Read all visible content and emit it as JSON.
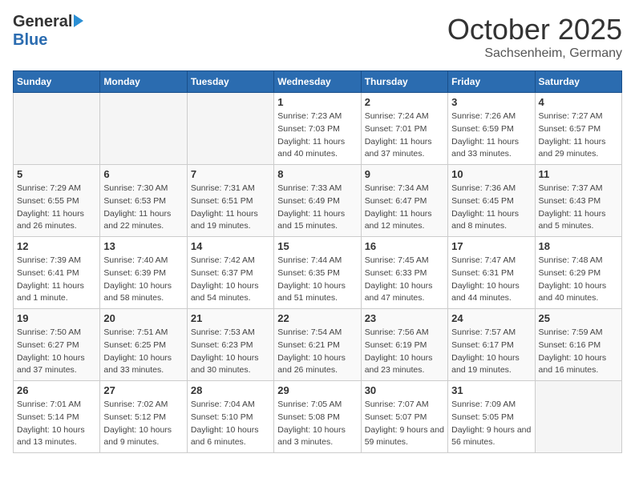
{
  "logo": {
    "general": "General",
    "blue": "Blue"
  },
  "title": "October 2025",
  "location": "Sachsenheim, Germany",
  "weekdays": [
    "Sunday",
    "Monday",
    "Tuesday",
    "Wednesday",
    "Thursday",
    "Friday",
    "Saturday"
  ],
  "weeks": [
    [
      {
        "day": "",
        "empty": true
      },
      {
        "day": "",
        "empty": true
      },
      {
        "day": "",
        "empty": true
      },
      {
        "day": "1",
        "sunrise": "7:23 AM",
        "sunset": "7:03 PM",
        "daylight": "11 hours and 40 minutes."
      },
      {
        "day": "2",
        "sunrise": "7:24 AM",
        "sunset": "7:01 PM",
        "daylight": "11 hours and 37 minutes."
      },
      {
        "day": "3",
        "sunrise": "7:26 AM",
        "sunset": "6:59 PM",
        "daylight": "11 hours and 33 minutes."
      },
      {
        "day": "4",
        "sunrise": "7:27 AM",
        "sunset": "6:57 PM",
        "daylight": "11 hours and 29 minutes."
      }
    ],
    [
      {
        "day": "5",
        "sunrise": "7:29 AM",
        "sunset": "6:55 PM",
        "daylight": "11 hours and 26 minutes."
      },
      {
        "day": "6",
        "sunrise": "7:30 AM",
        "sunset": "6:53 PM",
        "daylight": "11 hours and 22 minutes."
      },
      {
        "day": "7",
        "sunrise": "7:31 AM",
        "sunset": "6:51 PM",
        "daylight": "11 hours and 19 minutes."
      },
      {
        "day": "8",
        "sunrise": "7:33 AM",
        "sunset": "6:49 PM",
        "daylight": "11 hours and 15 minutes."
      },
      {
        "day": "9",
        "sunrise": "7:34 AM",
        "sunset": "6:47 PM",
        "daylight": "11 hours and 12 minutes."
      },
      {
        "day": "10",
        "sunrise": "7:36 AM",
        "sunset": "6:45 PM",
        "daylight": "11 hours and 8 minutes."
      },
      {
        "day": "11",
        "sunrise": "7:37 AM",
        "sunset": "6:43 PM",
        "daylight": "11 hours and 5 minutes."
      }
    ],
    [
      {
        "day": "12",
        "sunrise": "7:39 AM",
        "sunset": "6:41 PM",
        "daylight": "11 hours and 1 minute."
      },
      {
        "day": "13",
        "sunrise": "7:40 AM",
        "sunset": "6:39 PM",
        "daylight": "10 hours and 58 minutes."
      },
      {
        "day": "14",
        "sunrise": "7:42 AM",
        "sunset": "6:37 PM",
        "daylight": "10 hours and 54 minutes."
      },
      {
        "day": "15",
        "sunrise": "7:44 AM",
        "sunset": "6:35 PM",
        "daylight": "10 hours and 51 minutes."
      },
      {
        "day": "16",
        "sunrise": "7:45 AM",
        "sunset": "6:33 PM",
        "daylight": "10 hours and 47 minutes."
      },
      {
        "day": "17",
        "sunrise": "7:47 AM",
        "sunset": "6:31 PM",
        "daylight": "10 hours and 44 minutes."
      },
      {
        "day": "18",
        "sunrise": "7:48 AM",
        "sunset": "6:29 PM",
        "daylight": "10 hours and 40 minutes."
      }
    ],
    [
      {
        "day": "19",
        "sunrise": "7:50 AM",
        "sunset": "6:27 PM",
        "daylight": "10 hours and 37 minutes."
      },
      {
        "day": "20",
        "sunrise": "7:51 AM",
        "sunset": "6:25 PM",
        "daylight": "10 hours and 33 minutes."
      },
      {
        "day": "21",
        "sunrise": "7:53 AM",
        "sunset": "6:23 PM",
        "daylight": "10 hours and 30 minutes."
      },
      {
        "day": "22",
        "sunrise": "7:54 AM",
        "sunset": "6:21 PM",
        "daylight": "10 hours and 26 minutes."
      },
      {
        "day": "23",
        "sunrise": "7:56 AM",
        "sunset": "6:19 PM",
        "daylight": "10 hours and 23 minutes."
      },
      {
        "day": "24",
        "sunrise": "7:57 AM",
        "sunset": "6:17 PM",
        "daylight": "10 hours and 19 minutes."
      },
      {
        "day": "25",
        "sunrise": "7:59 AM",
        "sunset": "6:16 PM",
        "daylight": "10 hours and 16 minutes."
      }
    ],
    [
      {
        "day": "26",
        "sunrise": "7:01 AM",
        "sunset": "5:14 PM",
        "daylight": "10 hours and 13 minutes."
      },
      {
        "day": "27",
        "sunrise": "7:02 AM",
        "sunset": "5:12 PM",
        "daylight": "10 hours and 9 minutes."
      },
      {
        "day": "28",
        "sunrise": "7:04 AM",
        "sunset": "5:10 PM",
        "daylight": "10 hours and 6 minutes."
      },
      {
        "day": "29",
        "sunrise": "7:05 AM",
        "sunset": "5:08 PM",
        "daylight": "10 hours and 3 minutes."
      },
      {
        "day": "30",
        "sunrise": "7:07 AM",
        "sunset": "5:07 PM",
        "daylight": "9 hours and 59 minutes."
      },
      {
        "day": "31",
        "sunrise": "7:09 AM",
        "sunset": "5:05 PM",
        "daylight": "9 hours and 56 minutes."
      },
      {
        "day": "",
        "empty": true
      }
    ]
  ],
  "labels": {
    "sunrise": "Sunrise:",
    "sunset": "Sunset:",
    "daylight": "Daylight hours"
  }
}
